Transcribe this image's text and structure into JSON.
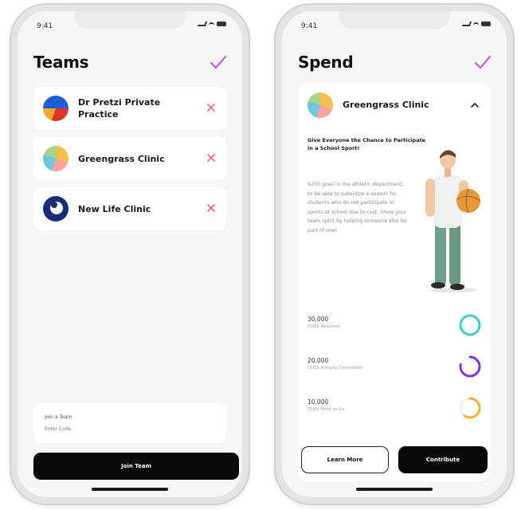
{
  "status_bar": {
    "time": "9:41"
  },
  "teams_screen": {
    "title": "Teams",
    "teams": [
      {
        "name": "Dr Pretzi Private Practice",
        "logo": "dr-pretzi-logo"
      },
      {
        "name": "Greengrass Clinic",
        "logo": "greengrass-logo"
      },
      {
        "name": "New Life Clinic",
        "logo": "new-life-logo"
      }
    ],
    "join": {
      "label": "Join a Team",
      "placeholder": "Enter Code",
      "button_label": "Join Team"
    }
  },
  "spend_screen": {
    "title": "Spend",
    "clinic_name": "Greengrass Clinic",
    "campaign_title": "Give Everyone the Chance to Participate in a School Sport!",
    "campaign_description": "$200 goes to the athletic department, to be able to subsidize a season for students who do not participate in sports at school due to cost. Show your team spirit by helping someone else be part of one!",
    "stats": [
      {
        "amount": "30,000",
        "label": "DUEs Required",
        "ring_color": "#3ecfc2",
        "progress": 1.0
      },
      {
        "amount": "20,000",
        "label": "DUEs Already Committed",
        "ring_color": "#7a35e0",
        "progress": 0.78
      },
      {
        "amount": "10,000",
        "label": "DUEs More to Go",
        "ring_color": "#f2b13a",
        "progress": 0.6
      }
    ],
    "learn_more_label": "Learn More",
    "contribute_label": "Contribute"
  },
  "colors": {
    "accent_check": "#c069e8",
    "remove_x": "#e8677a",
    "dark_button": "#0a0a0a"
  }
}
